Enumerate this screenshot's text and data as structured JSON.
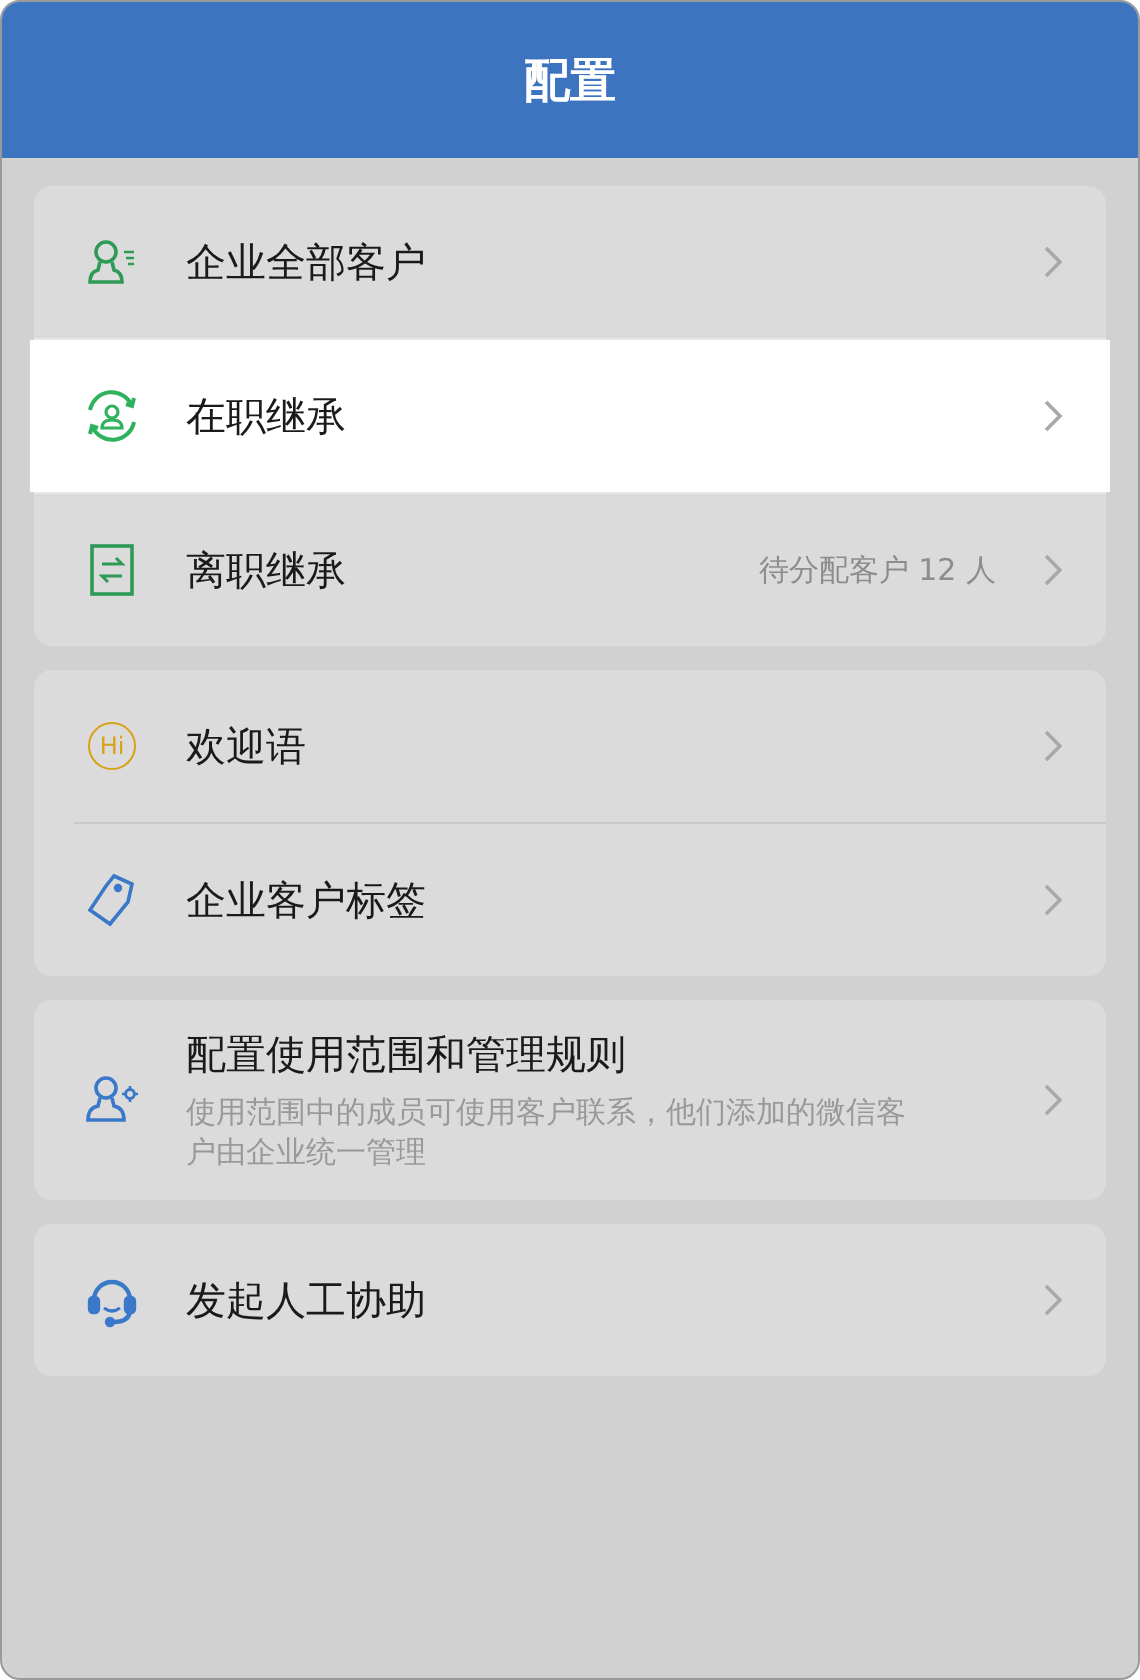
{
  "header": {
    "title": "配置"
  },
  "groups": [
    {
      "items": [
        {
          "kind": "person-list",
          "label": "企业全部客户",
          "selected": false
        },
        {
          "kind": "person-sync",
          "label": "在职继承",
          "selected": true
        },
        {
          "kind": "transfer",
          "label": "离职继承",
          "value": "待分配客户 12 人",
          "selected": false
        }
      ]
    },
    {
      "items": [
        {
          "kind": "hi",
          "icon_text": "Hi",
          "label": "欢迎语",
          "selected": false
        },
        {
          "kind": "tag",
          "label": "企业客户标签",
          "selected": false
        }
      ]
    },
    {
      "items": [
        {
          "kind": "person-gear",
          "label": "配置使用范围和管理规则",
          "description": "使用范围中的成员可使用客户联系，他们添加的微信客户由企业统一管理",
          "selected": false
        }
      ]
    },
    {
      "items": [
        {
          "kind": "headset",
          "label": "发起人工协助",
          "selected": false
        }
      ]
    }
  ]
}
